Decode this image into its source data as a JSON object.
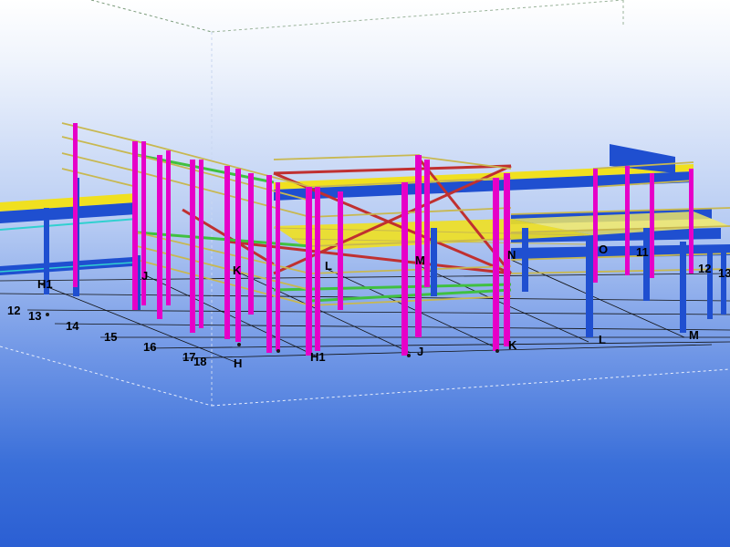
{
  "labels": {
    "row_labels": [
      "12",
      "13",
      "14",
      "15",
      "16",
      "17",
      "18"
    ],
    "front_grid": [
      "H",
      "H1",
      "J",
      "K",
      "L",
      "M"
    ],
    "upper_grid": [
      "H1",
      "J",
      "K",
      "L",
      "M",
      "N",
      "O"
    ],
    "right_labels": [
      "11",
      "12",
      "13"
    ]
  },
  "colors": {
    "background_top": "#ffffff",
    "background_bottom": "#2b5fd3",
    "column_magenta": "#e600c8",
    "beam_blue": "#1f4fd0",
    "beam_yellow": "#f0e020",
    "beam_red": "#c03030",
    "beam_green": "#40c040",
    "beam_cyan": "#30d0d0",
    "truss_tan": "#c8b850",
    "grid_line": "#000000",
    "work_area_line": "#ffffff"
  }
}
